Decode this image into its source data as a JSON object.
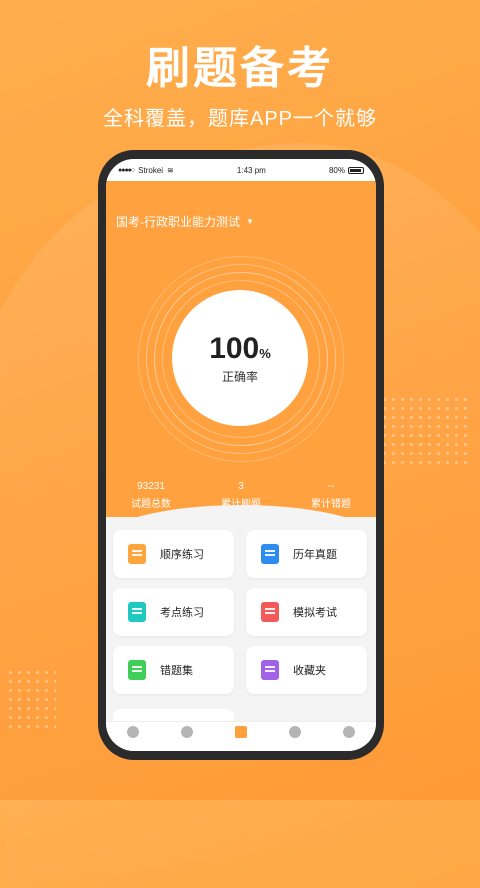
{
  "hero": {
    "title": "刷题备考",
    "subtitle": "全科覆盖，题库APP一个就够"
  },
  "statusbar": {
    "carrier": "Strokei",
    "time": "1:43 pm",
    "battery": "80%"
  },
  "exam": {
    "name": "国考-行政职业能力测试",
    "caret": "▼"
  },
  "accuracy": {
    "value": "100",
    "unit": "%",
    "label": "正确率"
  },
  "stats": [
    {
      "value": "93231",
      "label": "试题总数"
    },
    {
      "value": "3",
      "label": "累计刷题"
    },
    {
      "value": "--",
      "label": "累计错题"
    }
  ],
  "cards": [
    {
      "label": "顺序练习",
      "icon": "book-icon",
      "color": "#ffa53d"
    },
    {
      "label": "历年真题",
      "icon": "check-clipboard-icon",
      "color": "#2e8cf0"
    },
    {
      "label": "考点练习",
      "icon": "document-icon",
      "color": "#20c9c0"
    },
    {
      "label": "模拟考试",
      "icon": "pencil-paper-icon",
      "color": "#f35a5a"
    },
    {
      "label": "错题集",
      "icon": "wrong-doc-icon",
      "color": "#3fce58"
    },
    {
      "label": "收藏夹",
      "icon": "star-folder-icon",
      "color": "#a262e8"
    }
  ],
  "tabs": [
    {
      "icon": "home-icon",
      "active": false
    },
    {
      "icon": "piggy-bank-icon",
      "active": false
    },
    {
      "icon": "question-bank-icon",
      "active": true
    },
    {
      "icon": "video-icon",
      "active": false
    },
    {
      "icon": "profile-icon",
      "active": false
    }
  ]
}
